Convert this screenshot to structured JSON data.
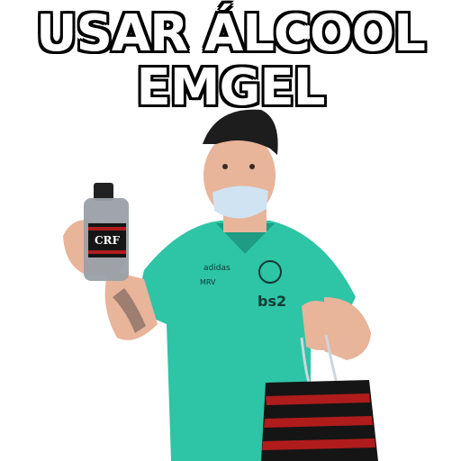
{
  "caption": {
    "line1": "USAR ÁLCOOL",
    "line2": "EMGEL"
  },
  "shirt": {
    "sponsor": "bs2",
    "brand": "adidas",
    "patch": "MRV"
  },
  "bottle": {
    "label": "CRF"
  },
  "colors": {
    "shirt": "#2ec4a6",
    "shirt_dark": "#1e9c84",
    "skin": "#e8b49a",
    "cap": "#1d1d1d",
    "mask": "#cfe3f2",
    "bag_red": "#b01c1c",
    "bag_black": "#151515",
    "bottle_glass": "#9aa0a6"
  }
}
